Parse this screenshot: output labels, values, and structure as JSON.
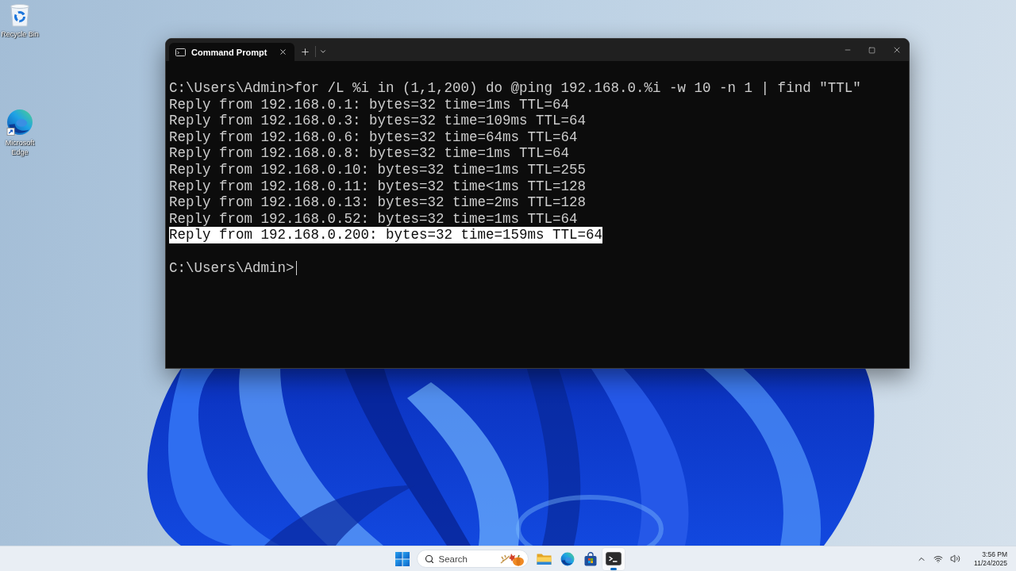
{
  "desktop": {
    "shortcuts": [
      {
        "kind": "recycle_bin",
        "label": "Recycle Bin"
      },
      {
        "kind": "browser",
        "label": "Microsoft Edge"
      }
    ]
  },
  "window": {
    "tabs": [
      {
        "title": "Command Prompt",
        "selected": true
      }
    ],
    "command": "C:\\Users\\Admin>for /L %i in (1,1,200) do @ping 192.168.0.%i -w 10 -n 1 | find \"TTL\"",
    "output": [
      {
        "text": "Reply from 192.168.0.1: bytes=32 time=1ms TTL=64",
        "selected": false
      },
      {
        "text": "Reply from 192.168.0.3: bytes=32 time=109ms TTL=64",
        "selected": false
      },
      {
        "text": "Reply from 192.168.0.6: bytes=32 time=64ms TTL=64",
        "selected": false
      },
      {
        "text": "Reply from 192.168.0.8: bytes=32 time=1ms TTL=64",
        "selected": false
      },
      {
        "text": "Reply from 192.168.0.10: bytes=32 time=1ms TTL=255",
        "selected": false
      },
      {
        "text": "Reply from 192.168.0.11: bytes=32 time<1ms TTL=128",
        "selected": false
      },
      {
        "text": "Reply from 192.168.0.13: bytes=32 time=2ms TTL=128",
        "selected": false
      },
      {
        "text": "Reply from 192.168.0.52: bytes=32 time=1ms TTL=64",
        "selected": false
      },
      {
        "text": "Reply from 192.168.0.200: bytes=32 time=159ms TTL=64",
        "selected": true
      }
    ],
    "prompt": "C:\\Users\\Admin>"
  },
  "taskbar": {
    "search": {
      "placeholder": "Search"
    },
    "apps": [
      {
        "kind": "explorer",
        "active": false
      },
      {
        "kind": "browser",
        "active": false
      },
      {
        "kind": "store",
        "active": false
      },
      {
        "kind": "terminal",
        "active": true
      }
    ],
    "clock": {
      "time": "3:56 PM",
      "date": "11/24/2025"
    }
  }
}
